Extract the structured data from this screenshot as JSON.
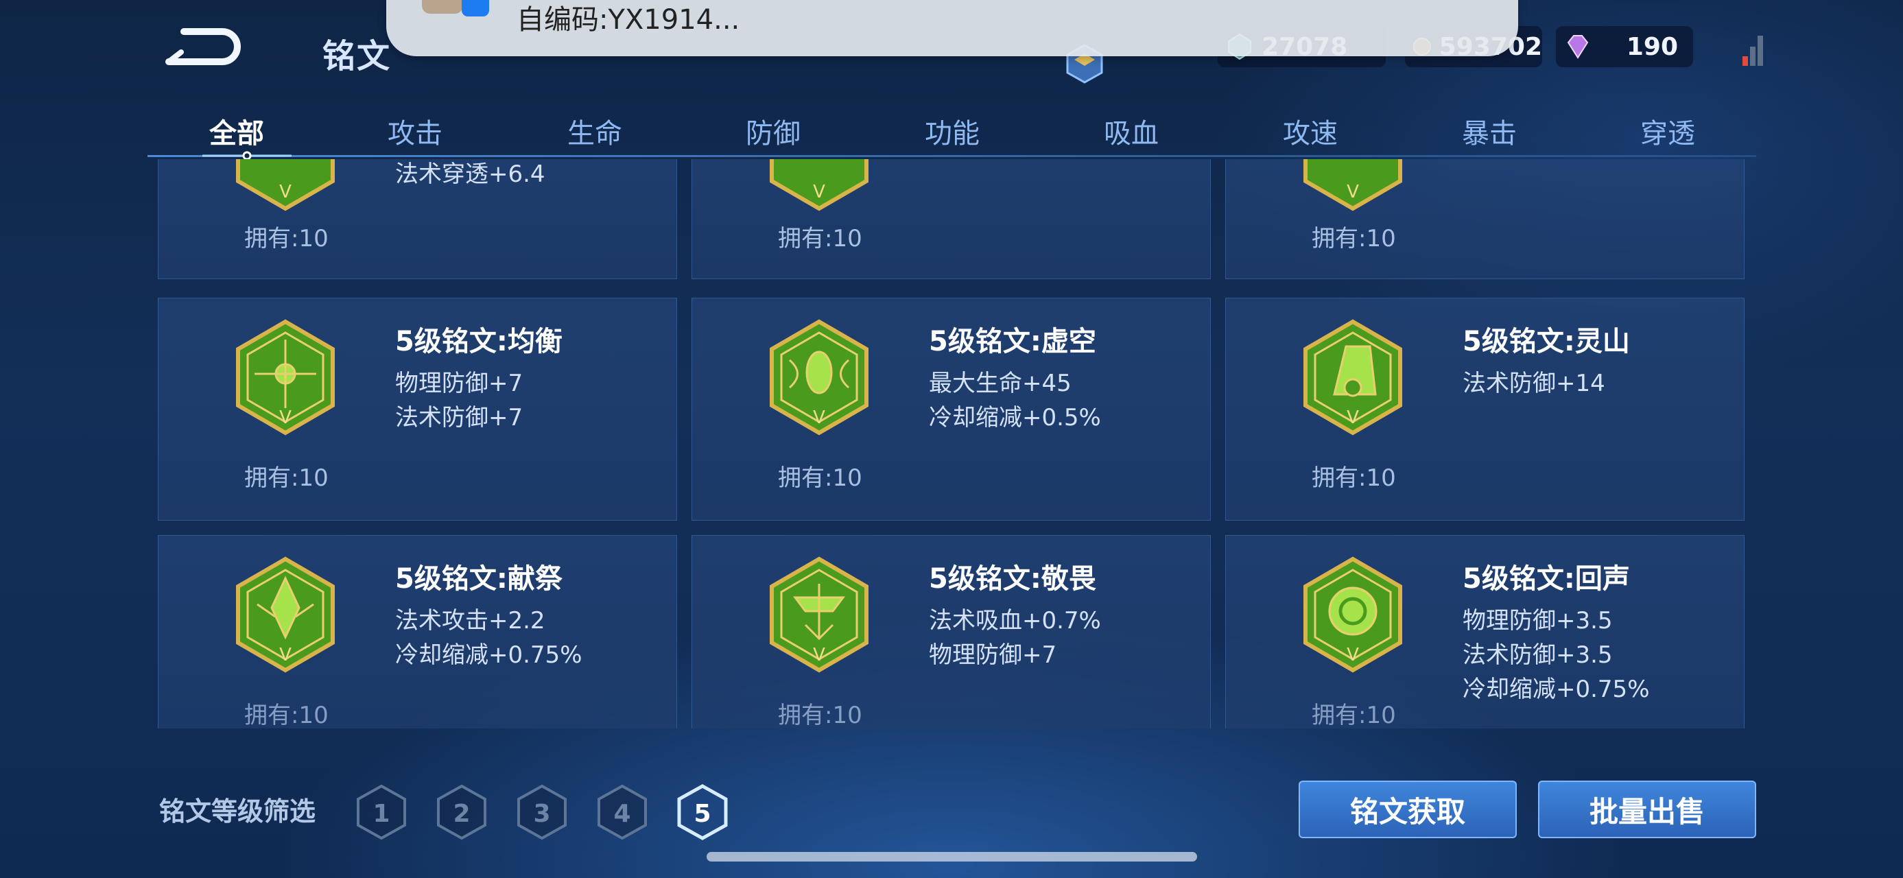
{
  "header": {
    "title": "铭文"
  },
  "resources": [
    {
      "name": "jade",
      "value": "27078"
    },
    {
      "name": "gold",
      "value": "593702"
    },
    {
      "name": "diamond",
      "value": "190"
    }
  ],
  "notification": {
    "text": "自编码:YX1914..."
  },
  "tabs": [
    {
      "label": "全部",
      "active": true
    },
    {
      "label": "攻击"
    },
    {
      "label": "生命"
    },
    {
      "label": "防御"
    },
    {
      "label": "功能"
    },
    {
      "label": "吸血"
    },
    {
      "label": "攻速"
    },
    {
      "label": "暴击"
    },
    {
      "label": "穿透"
    }
  ],
  "top_row": [
    {
      "attrs": [
        "法术穿透+6.4"
      ],
      "owned": "拥有:10"
    },
    {
      "attrs": [],
      "owned": "拥有:10"
    },
    {
      "attrs": [],
      "owned": "拥有:10"
    }
  ],
  "runes": [
    {
      "title": "5级铭文:均衡",
      "attrs": [
        "物理防御+7",
        "法术防御+7"
      ],
      "owned": "拥有:10"
    },
    {
      "title": "5级铭文:虚空",
      "attrs": [
        "最大生命+45",
        "冷却缩减+0.5%"
      ],
      "owned": "拥有:10"
    },
    {
      "title": "5级铭文:灵山",
      "attrs": [
        "法术防御+14"
      ],
      "owned": "拥有:10"
    },
    {
      "title": "5级铭文:献祭",
      "attrs": [
        "法术攻击+2.2",
        "冷却缩减+0.75%"
      ],
      "owned": "拥有:10"
    },
    {
      "title": "5级铭文:敬畏",
      "attrs": [
        "法术吸血+0.7%",
        "物理防御+7"
      ],
      "owned": "拥有:10"
    },
    {
      "title": "5级铭文:回声",
      "attrs": [
        "物理防御+3.5",
        "法术防御+3.5",
        "冷却缩减+0.75%"
      ],
      "owned": "拥有:10"
    }
  ],
  "filter": {
    "label": "铭文等级筛选",
    "levels": [
      "1",
      "2",
      "3",
      "4",
      "5"
    ],
    "selected": "5"
  },
  "buttons": {
    "get": "铭文获取",
    "sell": "批量出售"
  },
  "colors": {
    "accent": "#3f86dc",
    "emblem_green": "#4a9a1e",
    "emblem_gold": "#d8b44a"
  }
}
